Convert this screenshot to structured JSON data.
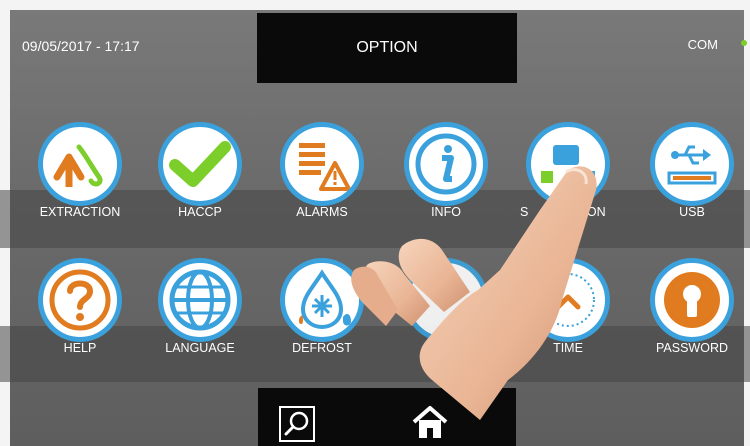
{
  "header": {
    "datetime": "09/05/2017 - 17:17",
    "title": "OPTION",
    "com_label": "COM",
    "com_status_color": "#7ccf2a"
  },
  "menu": {
    "row1": [
      {
        "label": "EXTRACTION",
        "icon": "extraction-icon"
      },
      {
        "label": "HACCP",
        "icon": "checkmark-icon"
      },
      {
        "label": "ALARMS",
        "icon": "alarm-warning-icon"
      },
      {
        "label": "INFO",
        "icon": "info-icon"
      },
      {
        "label": "S",
        "label_tail": "ATION",
        "icon": "system-configuration-icon"
      },
      {
        "label": "USB",
        "icon": "usb-icon"
      }
    ],
    "row2": [
      {
        "label": "HELP",
        "icon": "help-icon"
      },
      {
        "label": "LANGUAGE",
        "icon": "globe-icon"
      },
      {
        "label": "DEFROST",
        "icon": "defrost-icon"
      },
      {
        "label": "",
        "icon": "hidden-icon"
      },
      {
        "label": "TIME",
        "icon": "clock-icon"
      },
      {
        "label": "PASSWORD",
        "icon": "keyhole-icon"
      }
    ]
  },
  "bottom_bar": {
    "left_icon": "search-icon",
    "right_icon": "home-icon"
  },
  "colors": {
    "accent_blue": "#3aa1dc",
    "accent_orange": "#e07b1f",
    "accent_green": "#7ccf2a"
  }
}
